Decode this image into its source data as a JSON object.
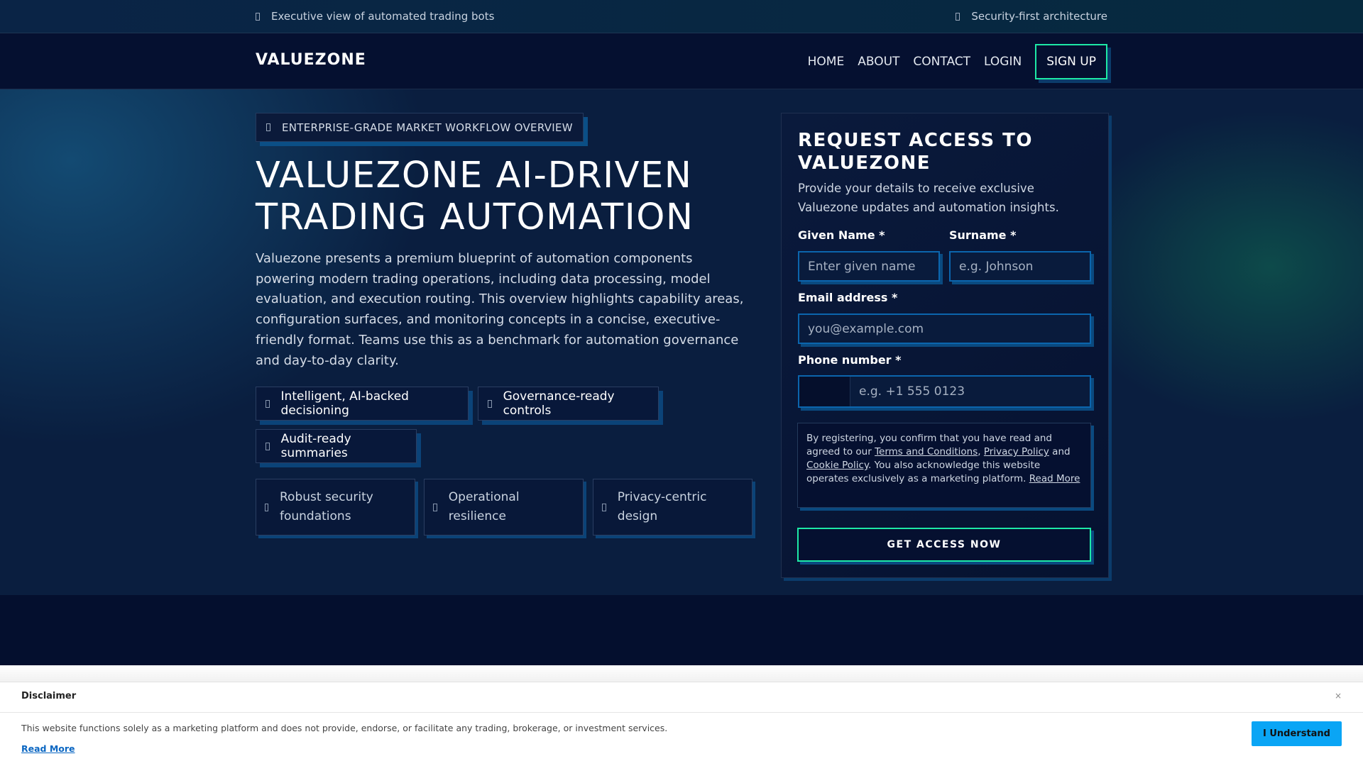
{
  "topbar": {
    "left": "Executive view of automated trading bots",
    "right": "Security-first architecture"
  },
  "nav": {
    "logo": "VALUEZONE",
    "links": [
      "HOME",
      "ABOUT",
      "CONTACT",
      "LOGIN"
    ],
    "signup": "SIGN UP"
  },
  "hero": {
    "badge": "ENTERPRISE-GRADE MARKET WORKFLOW OVERVIEW",
    "title": "VALUEZONE AI-DRIVEN TRADING AUTOMATION",
    "paragraph": "Valuezone presents a premium blueprint of automation components powering modern trading operations, including data processing, model evaluation, and execution routing. This overview highlights capability areas, configuration surfaces, and monitoring concepts in a concise, executive-friendly format. Teams use this as a benchmark for automation governance and day-to-day clarity.",
    "pills": [
      "Intelligent, AI-backed decisioning",
      "Governance-ready controls",
      "Audit-ready summaries"
    ],
    "cards": [
      "Robust security foundations",
      "Operational resilience",
      "Privacy-centric design"
    ]
  },
  "form": {
    "title": "REQUEST ACCESS TO VALUEZONE",
    "description": "Provide your details to receive exclusive Valuezone updates and automation insights.",
    "given_label": "Given Name *",
    "given_placeholder": "Enter given name",
    "surname_label": "Surname *",
    "surname_placeholder": "e.g. Johnson",
    "email_label": "Email address *",
    "email_placeholder": "you@example.com",
    "phone_label": "Phone number *",
    "phone_placeholder": "e.g. +1 555 0123",
    "consent": {
      "p1": "By registering, you confirm that you have read and agreed to our ",
      "terms": "Terms and Conditions",
      "sep": ", ",
      "privacy": "Privacy Policy",
      "and": " and ",
      "cookie": "Cookie Policy",
      "p2": ". You also acknowledge this website operates exclusively as a marketing platform. ",
      "read_more": "Read More"
    },
    "submit": "GET ACCESS NOW"
  },
  "disclaimer": {
    "title": "Disclaimer",
    "close": "×",
    "text": "This website functions solely as a marketing platform and does not provide, endorse, or facilitate any trading, brokerage, or investment services.",
    "read_more": "Read More",
    "button": "I Understand"
  }
}
